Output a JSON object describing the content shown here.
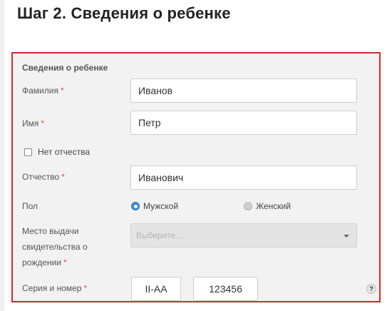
{
  "page": {
    "title": "Шаг 2. Сведения о ребенке"
  },
  "form": {
    "section_title": "Сведения о ребенке",
    "required_mark": "*",
    "surname": {
      "label": "Фамилия",
      "value": "Иванов"
    },
    "first_name": {
      "label": "Имя",
      "value": "Петр"
    },
    "no_patronymic": {
      "label": "Нет отчества",
      "checked": false
    },
    "patronymic": {
      "label": "Отчество",
      "value": "Иванович"
    },
    "gender": {
      "label": "Пол",
      "options": [
        "Мужской",
        "Женский"
      ],
      "selected": "Мужской"
    },
    "birth_cert_place": {
      "label_line1": "Место выдачи",
      "label_line2": "свидетельства о",
      "label_line3": "рождении",
      "placeholder": "Выберите..."
    },
    "series_number": {
      "label": "Серия и номер",
      "series": "II-АА",
      "number": "123456"
    },
    "help_icon_text": "?"
  },
  "colors": {
    "panel_border": "#d42a2a",
    "panel_background": "#f2f2f2",
    "radio_selected": "#3a8fd0",
    "required": "#e14b4b"
  }
}
